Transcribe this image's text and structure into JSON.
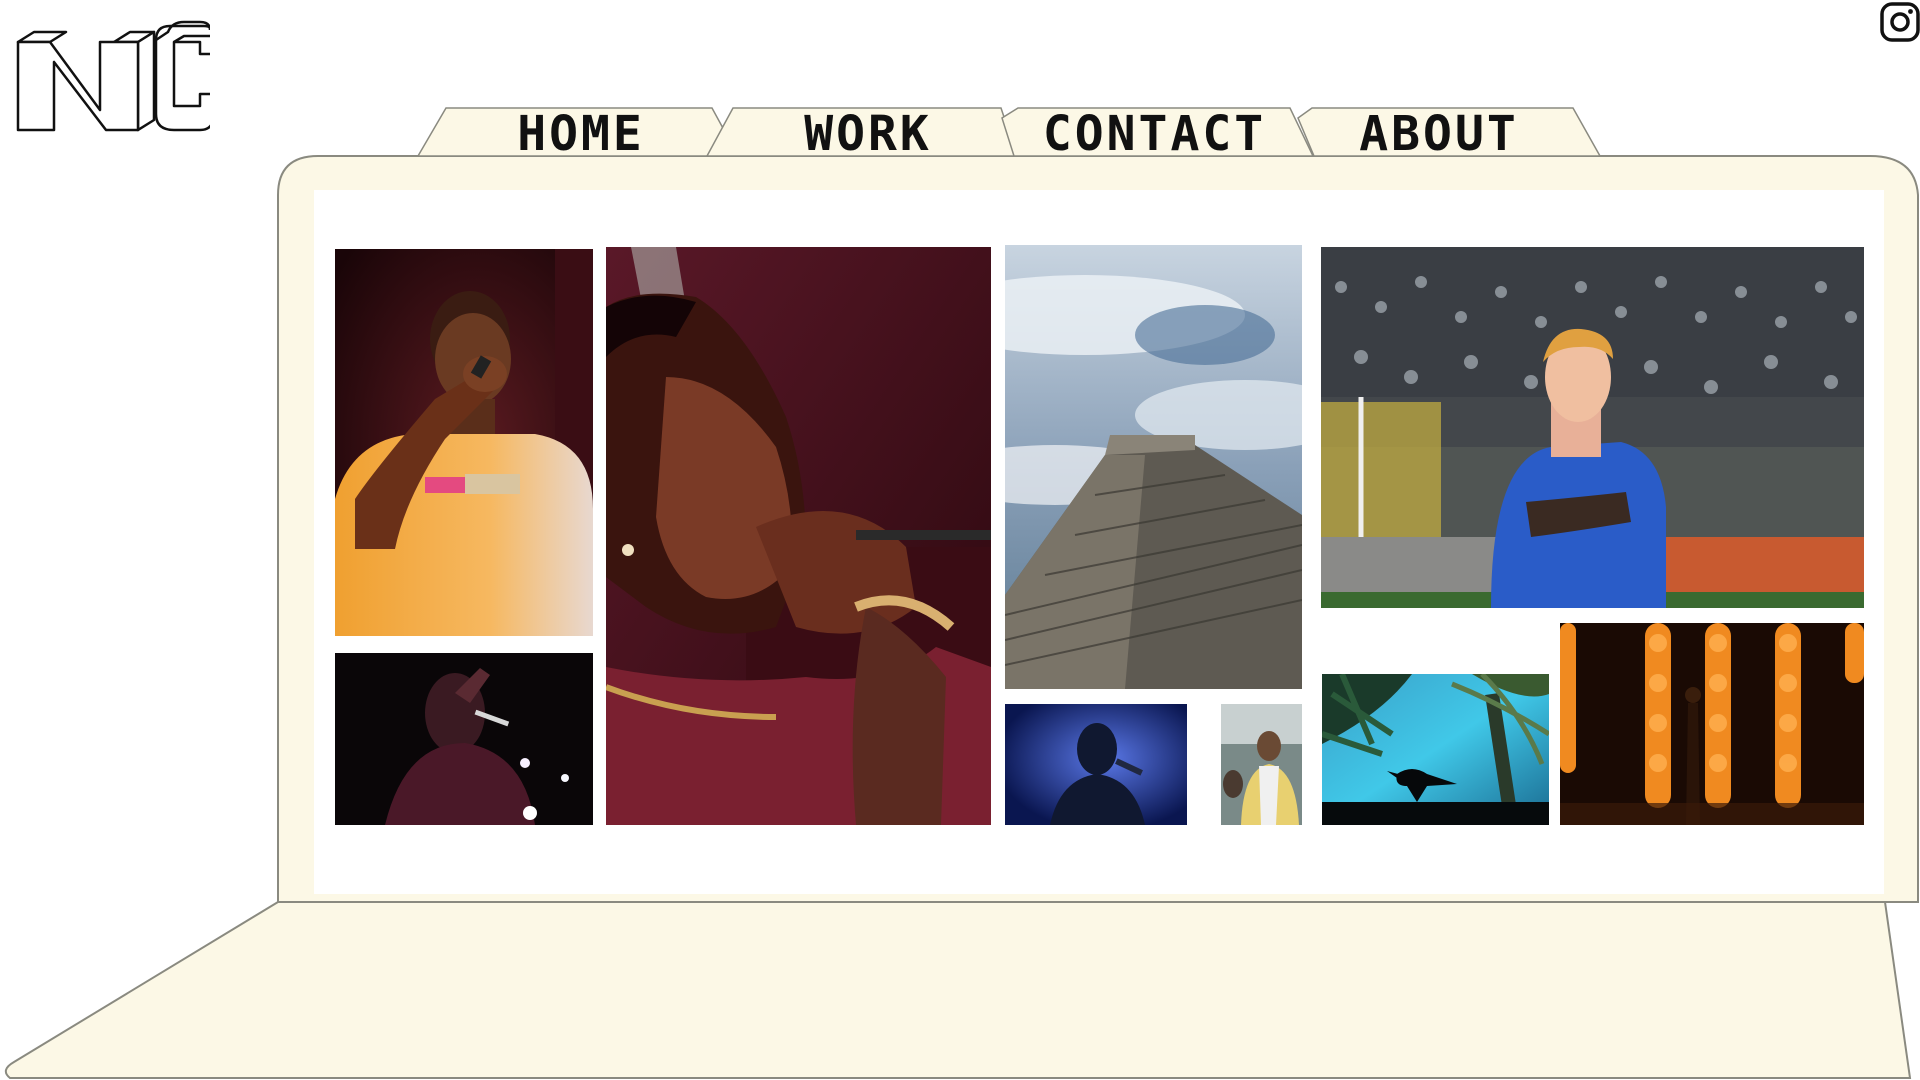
{
  "brand": {
    "logo_text": "NC",
    "logo_icon": "nc-3d-monogram"
  },
  "nav": {
    "tabs": [
      {
        "label": "HOME",
        "active": false
      },
      {
        "label": "WORK",
        "active": true
      },
      {
        "label": "CONTACT",
        "active": false
      },
      {
        "label": "ABOUT",
        "active": false
      }
    ]
  },
  "social": {
    "instagram_icon": "instagram-icon"
  },
  "gallery": {
    "photos": [
      {
        "subject": "rapper-orange-shirt-microphone"
      },
      {
        "subject": "rapper-profile-red-light"
      },
      {
        "subject": "chichen-itza-pyramid-clouds"
      },
      {
        "subject": "soccer-player-blue-jersey"
      },
      {
        "subject": "performer-dark-stage-lights"
      },
      {
        "subject": "singer-blue-silhouette"
      },
      {
        "subject": "man-yellow-shirt-crowd"
      },
      {
        "subject": "bird-silhouette-palm-blue"
      },
      {
        "subject": "stage-orange-light-columns"
      }
    ]
  },
  "colors": {
    "frame_fill": "#fcf8e6",
    "frame_stroke": "#8a8a80",
    "screen": "#ffffff",
    "ink": "#111111"
  }
}
